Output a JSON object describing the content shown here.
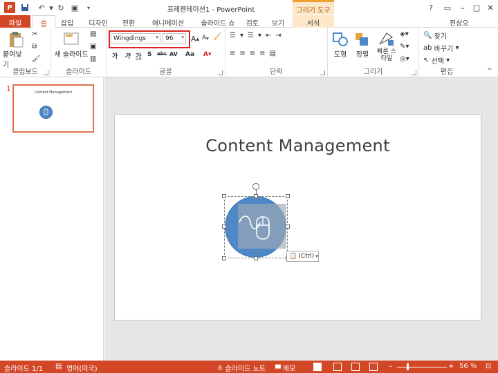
{
  "titlebar": {
    "window_title": "프레젠테이션1 - PowerPoint",
    "tools_header": "그리기 도구",
    "app_icon_letter": "P",
    "user": "전상오"
  },
  "tabs": [
    "파일",
    "홈",
    "삽입",
    "디자인",
    "전환",
    "애니메이션",
    "슬라이드 쇼",
    "검토",
    "보기",
    "서식"
  ],
  "ribbon": {
    "clipboard": {
      "label": "클립보드",
      "paste": "붙여넣기"
    },
    "slides": {
      "label": "슬라이드",
      "new_slide": "새 슬라이드"
    },
    "font": {
      "label": "글꼴",
      "font_name": "Wingdings",
      "font_size": "96",
      "format_buttons": [
        "가",
        "가",
        "가",
        "S",
        "abc",
        "AV",
        "Aa"
      ]
    },
    "paragraph": {
      "label": "단락"
    },
    "drawing": {
      "label": "그리기",
      "shapes": "도형",
      "arrange": "정렬",
      "quick_styles": "빠른 스타일"
    },
    "editing": {
      "label": "편집",
      "find": "찾기",
      "replace": "바꾸기",
      "select": "선택"
    }
  },
  "slide_panel": {
    "slide_number": "1",
    "thumb_title": "Content Management"
  },
  "slide": {
    "title": "Content Management"
  },
  "paste_options": {
    "label": "(Ctrl)"
  },
  "statusbar": {
    "slide_info": "슬라이드 1/1",
    "language": "영어(미국)",
    "notes": "슬라이드 노트",
    "comments": "메모",
    "zoom": "56 %"
  },
  "colors": {
    "accent": "#d24726",
    "shape_fill": "#4e88c7",
    "highlight_box": "#e02020"
  }
}
